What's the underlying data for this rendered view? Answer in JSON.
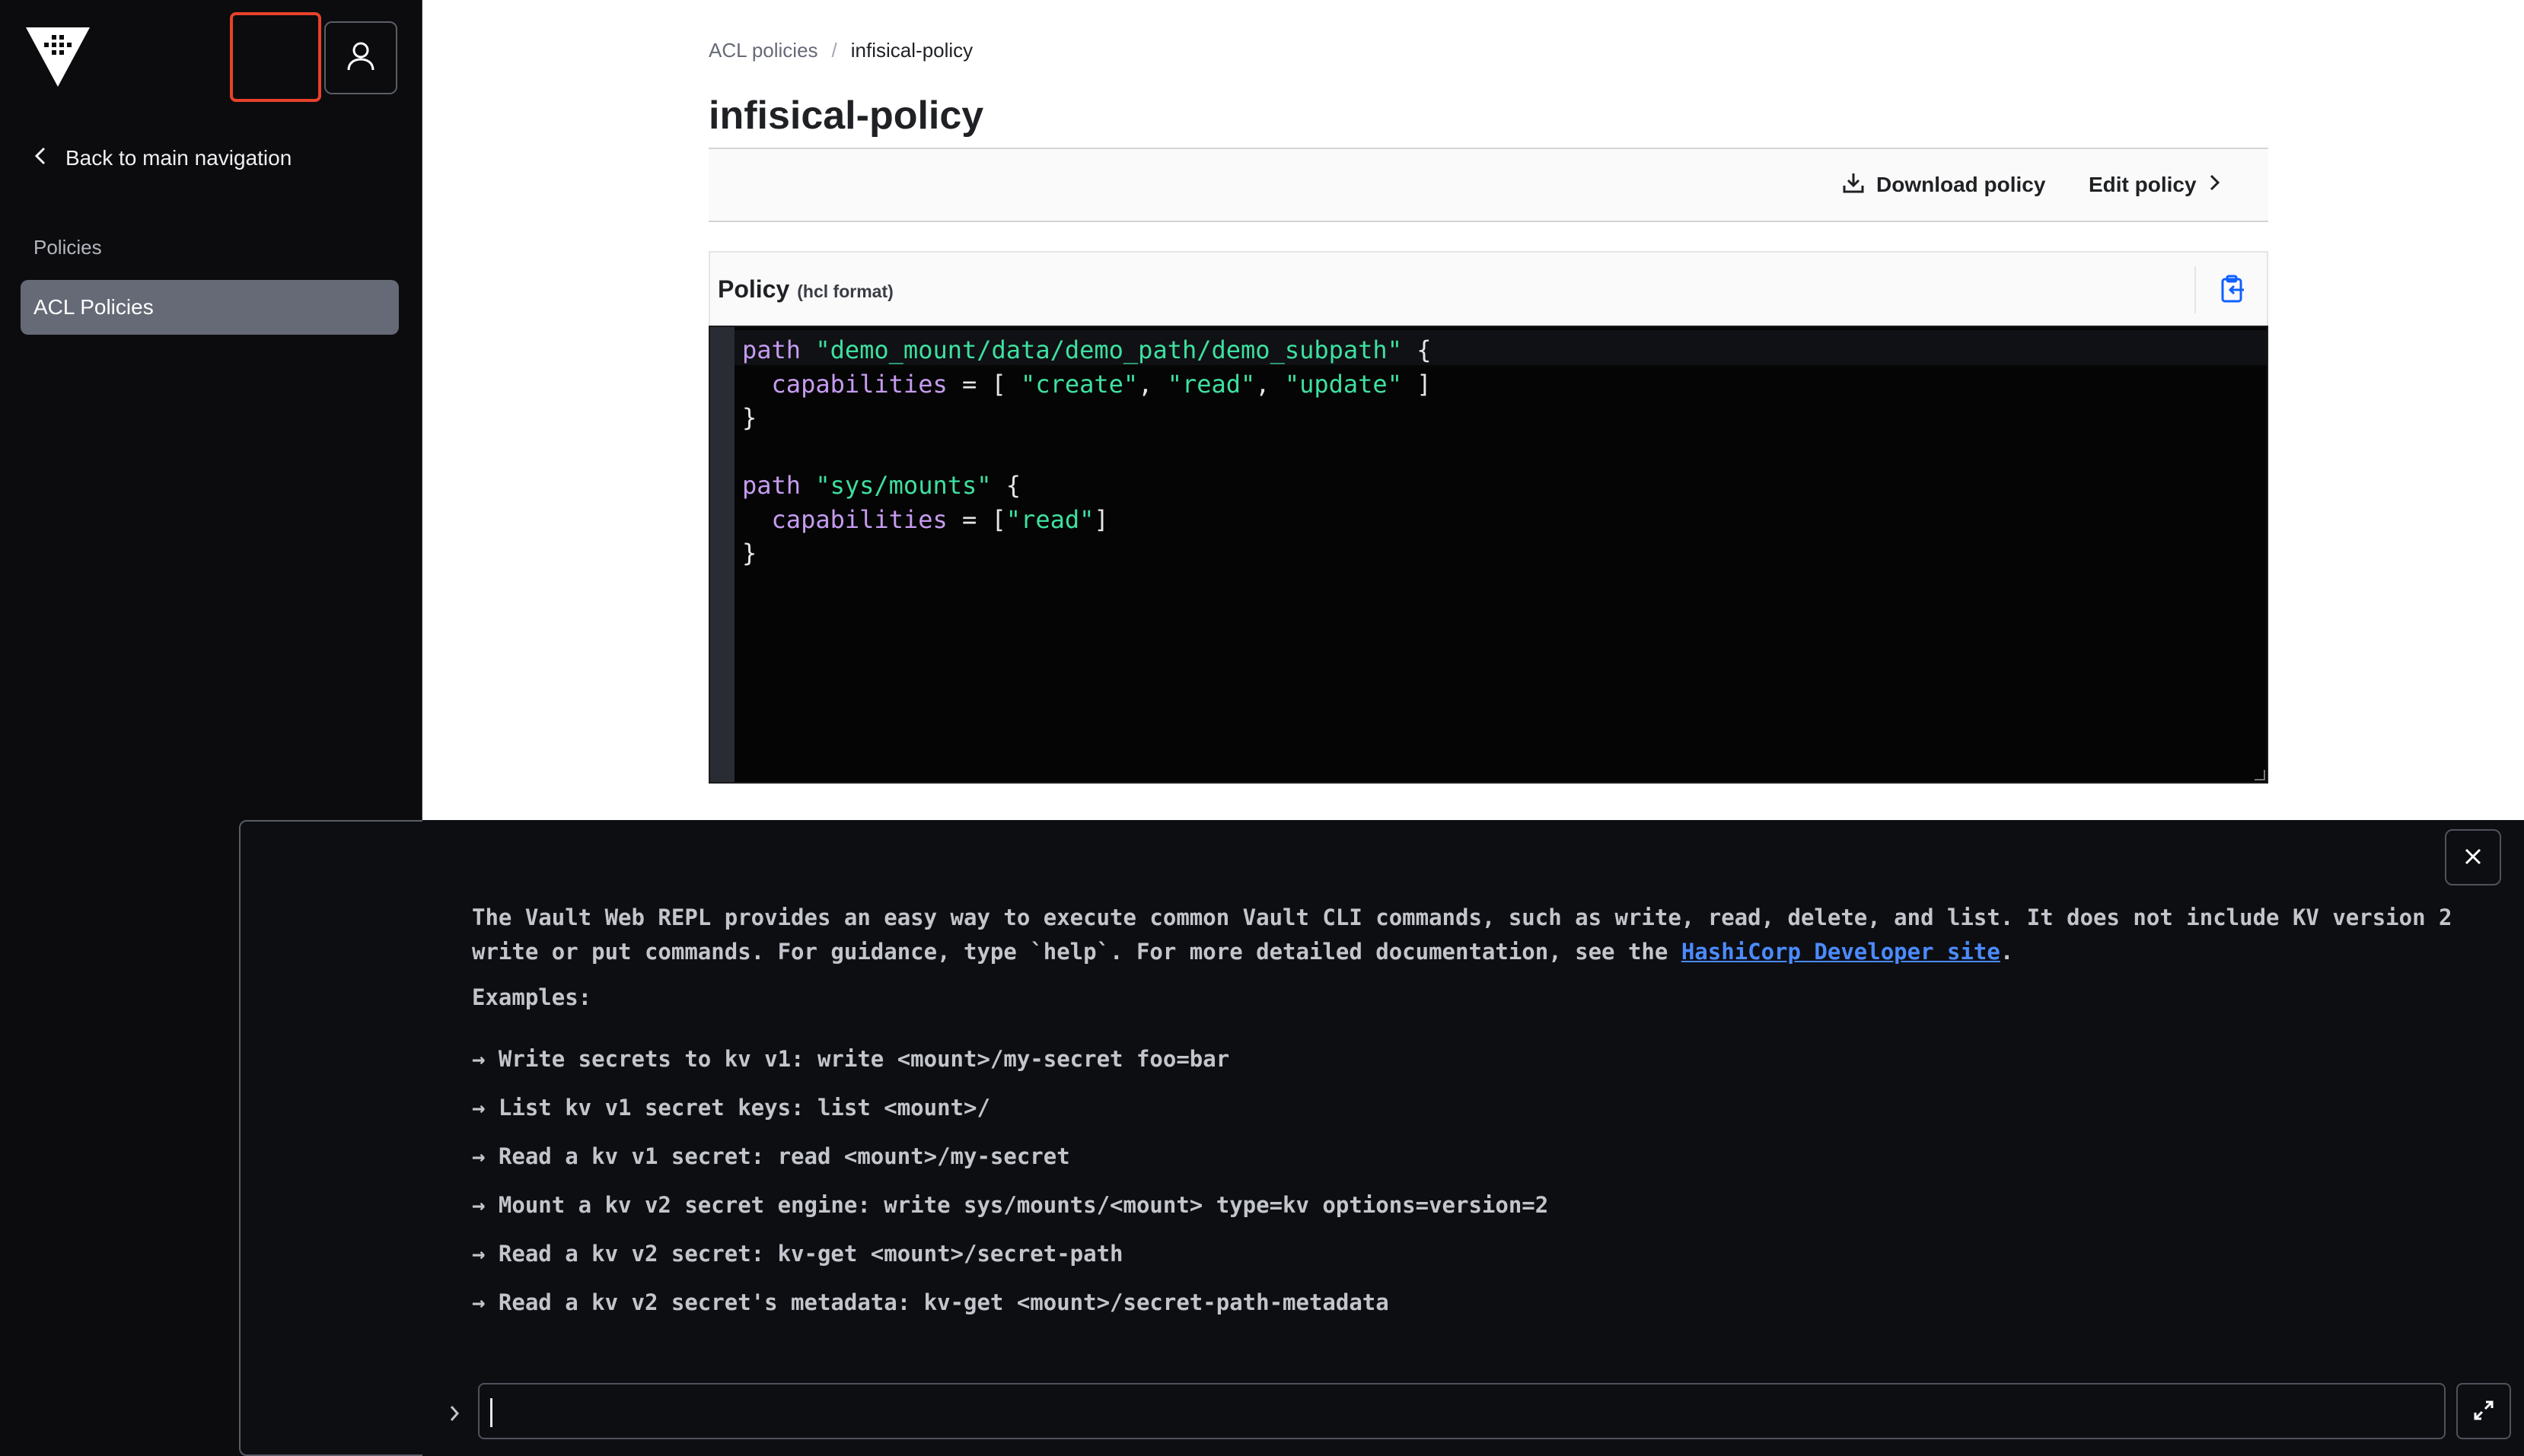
{
  "sidebar": {
    "logo_icon": "vault-logo-icon",
    "back_label": "Back to main navigation",
    "section_heading": "Policies",
    "items": [
      {
        "label": "ACL Policies",
        "active": true
      }
    ]
  },
  "header": {
    "console_icon": "terminal-icon",
    "user_icon": "user-icon"
  },
  "breadcrumb": {
    "parent": "ACL policies",
    "separator": "/",
    "current": "infisical-policy"
  },
  "page": {
    "title": "infisical-policy"
  },
  "toolbar": {
    "download_label": "Download policy",
    "edit_label": "Edit policy"
  },
  "policy": {
    "label": "Policy",
    "format_note": "(hcl format)",
    "lines": [
      [
        {
          "t": "path",
          "c": "kw"
        },
        {
          "t": " "
        },
        {
          "t": "\"demo_mount/data/demo_path/demo_subpath\"",
          "c": "str"
        },
        {
          "t": " {"
        }
      ],
      [
        {
          "t": "  "
        },
        {
          "t": "capabilities",
          "c": "kw"
        },
        {
          "t": " = [ "
        },
        {
          "t": "\"create\"",
          "c": "str"
        },
        {
          "t": ", "
        },
        {
          "t": "\"read\"",
          "c": "str"
        },
        {
          "t": ", "
        },
        {
          "t": "\"update\"",
          "c": "str"
        },
        {
          "t": " ]"
        }
      ],
      [
        {
          "t": "}"
        }
      ],
      [
        {
          "t": ""
        }
      ],
      [
        {
          "t": "path",
          "c": "kw"
        },
        {
          "t": " "
        },
        {
          "t": "\"sys/mounts\"",
          "c": "str"
        },
        {
          "t": " {"
        }
      ],
      [
        {
          "t": "  "
        },
        {
          "t": "capabilities",
          "c": "kw"
        },
        {
          "t": " = ["
        },
        {
          "t": "\"read\"",
          "c": "str"
        },
        {
          "t": "]"
        }
      ],
      [
        {
          "t": "}"
        }
      ]
    ]
  },
  "console": {
    "intro_text": "The Vault Web REPL provides an easy way to execute common Vault CLI commands, such as write, read, delete, and list. It does not include KV version 2 write or put commands. For guidance, type `help`. For more detailed documentation, see the ",
    "intro_link": "HashiCorp Developer site",
    "intro_end": ".",
    "examples_title": "Examples:",
    "examples": [
      "→ Write secrets to kv v1: write <mount>/my-secret foo=bar",
      "→ List kv v1 secret keys: list <mount>/",
      "→ Read a kv v1 secret: read <mount>/my-secret",
      "→ Mount a kv v2 secret engine: write sys/mounts/<mount> type=kv options=version=2",
      "→ Read a kv v2 secret: kv-get <mount>/secret-path",
      "→ Read a kv v2 secret's metadata: kv-get <mount>/secret-path-metadata"
    ],
    "input_value": ""
  },
  "colors": {
    "sidebar_bg": "#0c0c0e",
    "active_item": "#656a76",
    "highlight": "#e8412b",
    "code_keyword": "#c59cf0",
    "code_string": "#3ee09f",
    "link": "#4b8bff"
  }
}
